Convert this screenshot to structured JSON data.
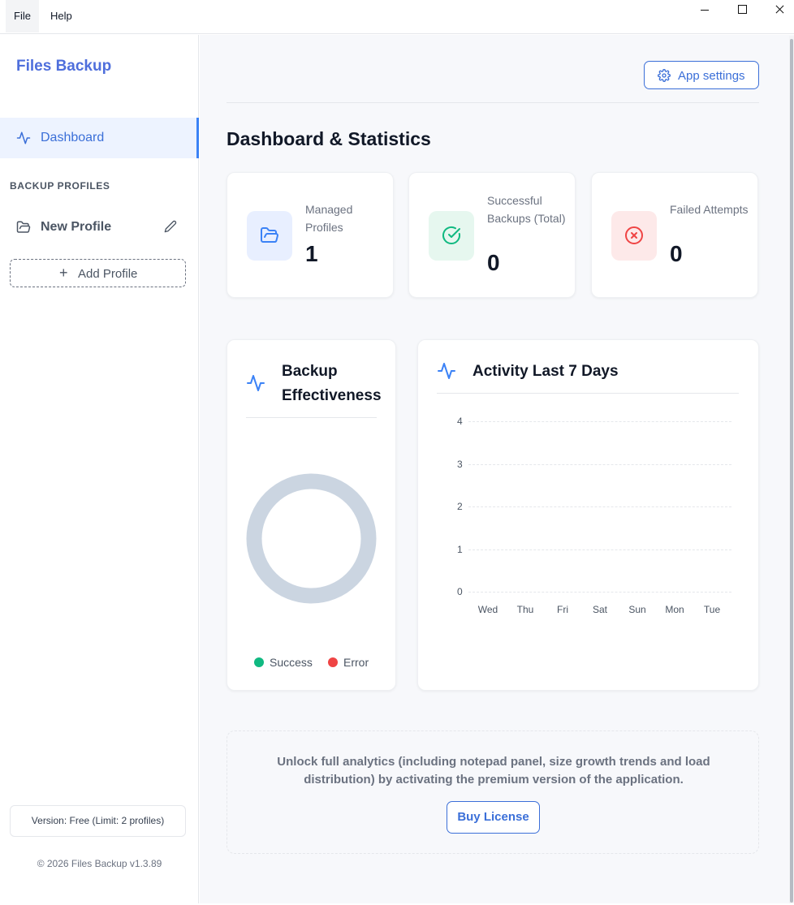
{
  "menu": {
    "file": "File",
    "help": "Help"
  },
  "sidebar": {
    "brand": "Files Backup",
    "nav": {
      "dashboard": "Dashboard"
    },
    "section_title": "BACKUP PROFILES",
    "profiles": [
      {
        "name": "New Profile"
      }
    ],
    "add_profile": "Add Profile",
    "version": "Version: Free (Limit: 2 profiles)",
    "copyright": "© 2026 Files Backup v1.3.89"
  },
  "header": {
    "app_settings": "App settings"
  },
  "main": {
    "title": "Dashboard & Statistics",
    "stats": [
      {
        "label": "Managed Profiles",
        "value": "1",
        "icon": "folder-open-icon",
        "color": "#3b82f6"
      },
      {
        "label": "Successful Backups (Total)",
        "value": "0",
        "icon": "check-circle-icon",
        "color": "#10b981"
      },
      {
        "label": "Failed Attempts",
        "value": "0",
        "icon": "x-circle-icon",
        "color": "#ef4444"
      }
    ],
    "effectiveness": {
      "title": "Backup Effectiveness",
      "legend": [
        {
          "label": "Success",
          "color": "#10b981"
        },
        {
          "label": "Error",
          "color": "#ef4444"
        }
      ]
    },
    "activity": {
      "title": "Activity Last 7 Days"
    },
    "promo": {
      "text": "Unlock full analytics (including notepad panel, size growth trends and load distribution) by activating the premium version of the application.",
      "button": "Buy License"
    }
  },
  "chart_data": [
    {
      "type": "pie",
      "title": "Backup Effectiveness",
      "categories": [
        "Success",
        "Error"
      ],
      "values": [
        0,
        0
      ],
      "colors": [
        "#10b981",
        "#ef4444"
      ],
      "legend": "bottom"
    },
    {
      "type": "line",
      "title": "Activity Last 7 Days",
      "categories": [
        "Wed",
        "Thu",
        "Fri",
        "Sat",
        "Sun",
        "Mon",
        "Tue"
      ],
      "series": [],
      "ylim": [
        0,
        4
      ],
      "yticks": [
        0,
        1,
        2,
        3,
        4
      ],
      "grid": true
    }
  ]
}
